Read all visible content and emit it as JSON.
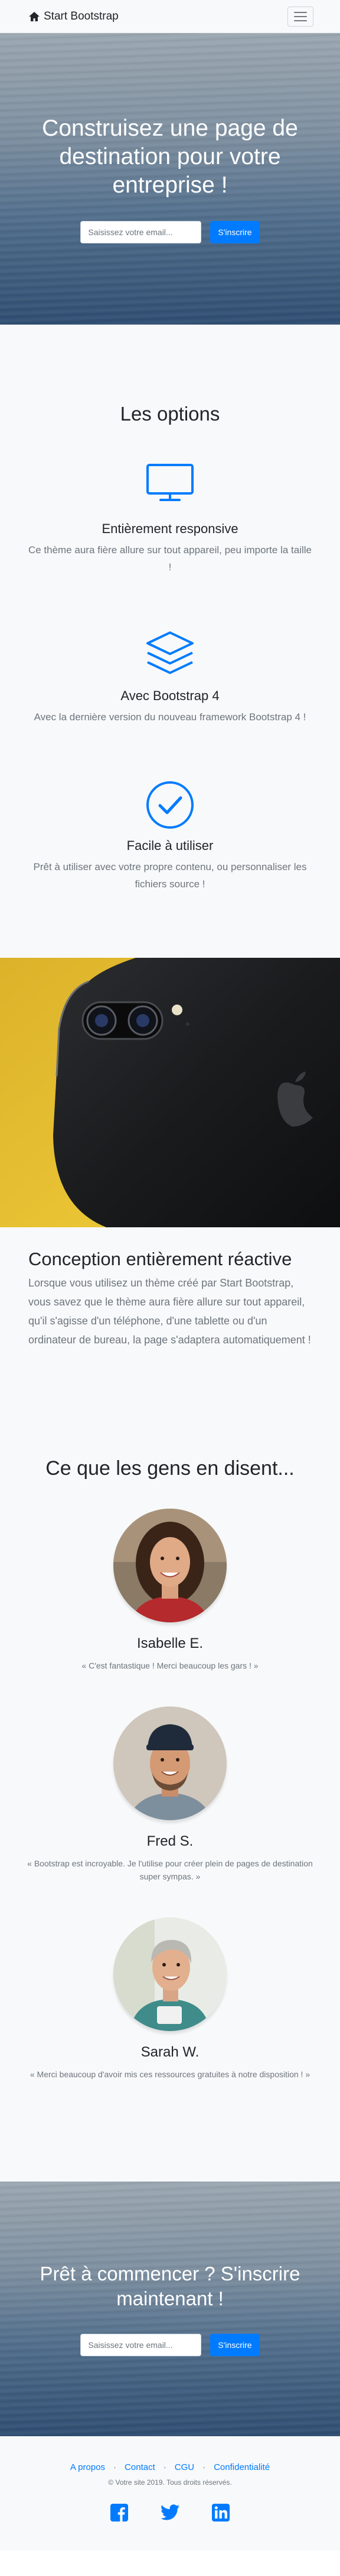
{
  "navbar": {
    "brand": "Start Bootstrap",
    "home_icon": "home-icon",
    "menu_icon": "hamburger-menu-icon"
  },
  "hero": {
    "title": "Construisez une page de destination pour votre entreprise !",
    "email_placeholder": "Saisissez votre email...",
    "submit_label": "S'inscrire"
  },
  "features": {
    "title": "Les options",
    "items": [
      {
        "icon": "monitor-icon",
        "title": "Entièrement responsive",
        "text": "Ce thème aura fière allure sur tout appareil, peu importe la taille !"
      },
      {
        "icon": "layers-icon",
        "title": "Avec Bootstrap 4",
        "text": "Avec la dernière version du nouveau framework Bootstrap 4 !"
      },
      {
        "icon": "check-circle-icon",
        "title": "Facile à utiliser",
        "text": "Prêt à utiliser avec votre propre contenu, ou personnaliser les fichiers source !"
      }
    ]
  },
  "showcase": {
    "title": "Conception entièrement réactive",
    "text": "Lorsque vous utilisez un thème créé par Start Bootstrap, vous savez que le thème aura fière allure sur tout appareil, qu'il s'agisse d'un téléphone, d'une tablette ou d'un ordinateur de bureau, la page s'adaptera automatiquement !"
  },
  "testimonials": {
    "title": "Ce que les gens en disent...",
    "items": [
      {
        "name": "Isabelle E.",
        "quote": "« C'est fantastique ! Merci beaucoup les gars ! »"
      },
      {
        "name": "Fred S.",
        "quote": "« Bootstrap est incroyable. Je l'utilise pour créer plein de pages de destination super sympas. »"
      },
      {
        "name": "Sarah W.",
        "quote": "« Merci beaucoup d'avoir mis ces ressources gratuites à notre disposition ! »"
      }
    ]
  },
  "cta": {
    "title": "Prêt à commencer ? S'inscrire maintenant !",
    "email_placeholder": "Saisissez votre email...",
    "submit_label": "S'inscrire"
  },
  "footer": {
    "links": [
      "A propos",
      "Contact",
      "CGU",
      "Confidentialité"
    ],
    "separator": "·",
    "copyright": "© Votre site 2019. Tous droits réservés.",
    "social_icons": [
      "facebook-icon",
      "twitter-icon",
      "linkedin-icon"
    ]
  },
  "colors": {
    "primary": "#007bff",
    "muted": "#6c757d",
    "light_bg": "#f8f9fa"
  }
}
